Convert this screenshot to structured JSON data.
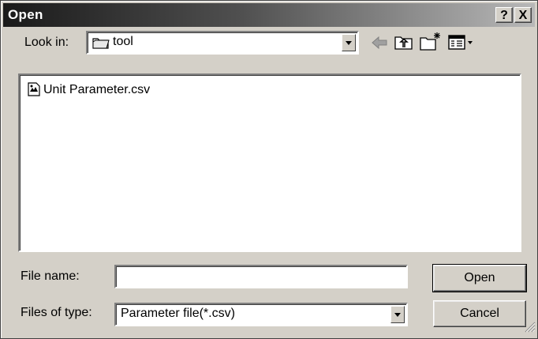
{
  "window": {
    "title": "Open",
    "help_label": "?",
    "close_label": "X"
  },
  "look_in": {
    "label": "Look in:",
    "value": "tool"
  },
  "toolbar": {
    "icons": [
      "back-arrow-icon",
      "up-one-level-icon",
      "new-folder-icon",
      "view-menu-icon"
    ]
  },
  "files": [
    {
      "name": "Unit Parameter.csv",
      "icon": "csv-file-icon"
    }
  ],
  "file_name": {
    "label": "File name:",
    "value": ""
  },
  "files_of_type": {
    "label": "Files of type:",
    "value": "Parameter file(*.csv)"
  },
  "buttons": {
    "open": "Open",
    "cancel": "Cancel"
  }
}
